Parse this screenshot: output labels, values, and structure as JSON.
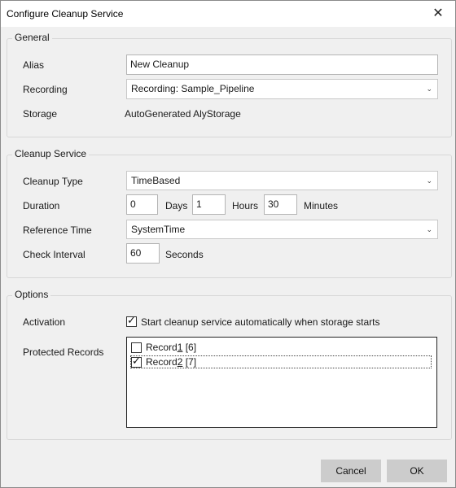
{
  "window": {
    "title": "Configure Cleanup Service",
    "close_icon": "close-icon"
  },
  "general": {
    "legend": "General",
    "alias_label": "Alias",
    "alias_value": "New Cleanup",
    "recording_label": "Recording",
    "recording_value": "Recording: Sample_Pipeline",
    "storage_label": "Storage",
    "storage_value": "AutoGenerated AlyStorage"
  },
  "cleanup": {
    "legend": "Cleanup Service",
    "type_label": "Cleanup Type",
    "type_value": "TimeBased",
    "duration_label": "Duration",
    "days_value": "0",
    "days_unit": "Days",
    "hours_value": "1",
    "hours_unit": "Hours",
    "minutes_value": "30",
    "minutes_unit": "Minutes",
    "reference_label": "Reference Time",
    "reference_value": "SystemTime",
    "interval_label": "Check Interval",
    "interval_value": "60",
    "interval_unit": "Seconds"
  },
  "options": {
    "legend": "Options",
    "activation_label": "Activation",
    "activation_checked": true,
    "activation_text": "Start cleanup service automatically when storage starts",
    "protected_label": "Protected Records",
    "records": [
      {
        "prefix": "Record",
        "num": "1",
        "count": " [6]",
        "checked": false
      },
      {
        "prefix": "Record",
        "num": "2",
        "count": " [7]",
        "checked": true
      }
    ]
  },
  "footer": {
    "cancel_label": "Cancel",
    "ok_label": "OK"
  }
}
